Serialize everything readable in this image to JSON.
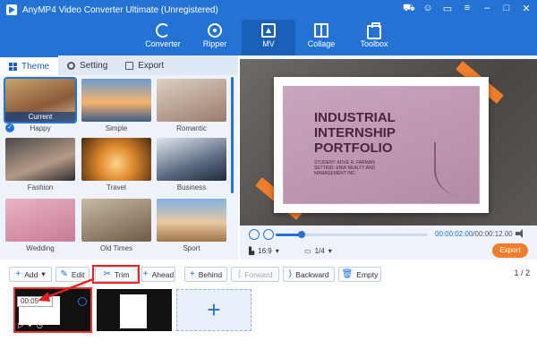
{
  "app": {
    "title": "AnyMP4 Video Converter Ultimate (Unregistered)"
  },
  "window_icons": [
    "cart-icon",
    "user-icon",
    "chat-icon",
    "menu-icon",
    "minimize-icon",
    "maximize-icon",
    "close-icon"
  ],
  "nav": {
    "items": [
      {
        "label": "Converter",
        "icon": "converter-icon"
      },
      {
        "label": "Ripper",
        "icon": "ripper-icon"
      },
      {
        "label": "MV",
        "icon": "mv-icon",
        "active": true
      },
      {
        "label": "Collage",
        "icon": "collage-icon"
      },
      {
        "label": "Toolbox",
        "icon": "toolbox-icon"
      }
    ]
  },
  "tabs": [
    {
      "label": "Theme",
      "active": true
    },
    {
      "label": "Setting"
    },
    {
      "label": "Export"
    }
  ],
  "themes": [
    {
      "label": "Happy",
      "current_tag": "Current",
      "selected": true
    },
    {
      "label": "Simple"
    },
    {
      "label": "Romantic"
    },
    {
      "label": "Fashion"
    },
    {
      "label": "Travel"
    },
    {
      "label": "Business"
    },
    {
      "label": "Wedding"
    },
    {
      "label": "Old Times"
    },
    {
      "label": "Sport"
    }
  ],
  "preview": {
    "title_line1": "INDUSTRIAL",
    "title_line2": "INTERNSHIP",
    "title_line3": "PORTFOLIO",
    "subtitle": "STUDENT: ADVE R. FARMAN SETTING: ENW REALTY AND MANAGEMENT INC.",
    "progress_fraction": 0.17
  },
  "player": {
    "current_time": "00:00:02.00",
    "total_time": "/00:00:12.00",
    "aspect_ratio": "16:9",
    "page": "1/4",
    "export_label": "Export"
  },
  "toolbar": {
    "add": "Add",
    "edit": "Edit",
    "trim": "Trim",
    "ahead": "Ahead",
    "behind": "Behind",
    "forward": "Forward",
    "backward": "Backward",
    "empty": "Empty",
    "pager": "1 / 2"
  },
  "timeline": {
    "clip1_duration": "00:05",
    "add_symbol": "+"
  },
  "colors": {
    "brand_blue": "#2473d4",
    "accent_orange": "#f07d2a",
    "highlight_red": "#e22222"
  }
}
